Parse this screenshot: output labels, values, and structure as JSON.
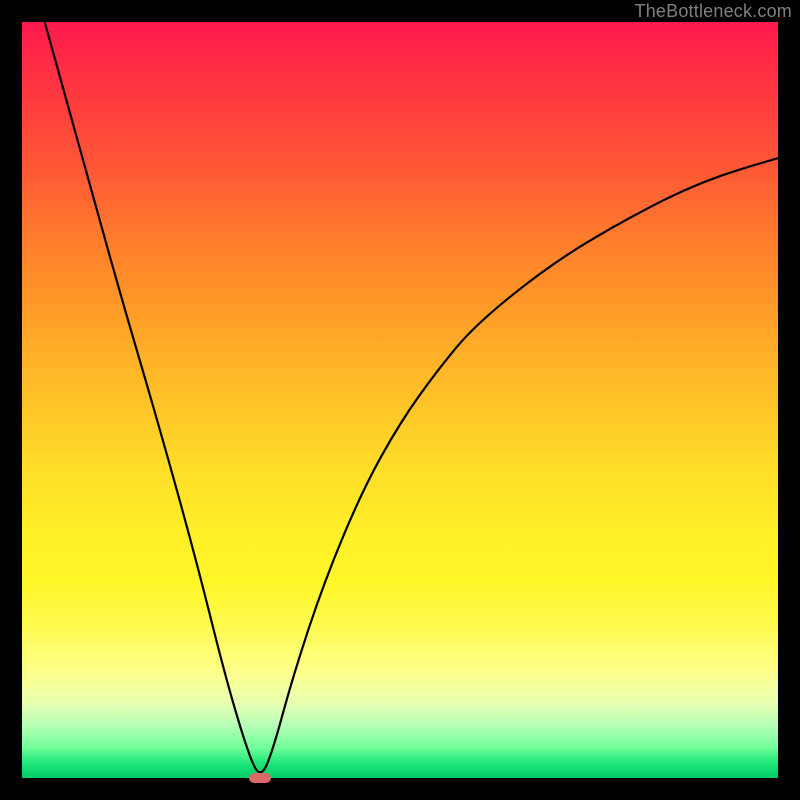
{
  "watermark": "TheBottleneck.com",
  "chart_data": {
    "type": "line",
    "title": "",
    "xlabel": "",
    "ylabel": "",
    "xlim": [
      0,
      100
    ],
    "ylim": [
      0,
      100
    ],
    "grid": false,
    "legend": false,
    "series": [
      {
        "name": "curve",
        "x": [
          3,
          8,
          13,
          18,
          23,
          27,
          30,
          31.5,
          33,
          36,
          40,
          45,
          50,
          55,
          60,
          70,
          80,
          90,
          100
        ],
        "y": [
          100,
          82,
          64,
          47,
          29,
          13,
          3,
          0,
          3,
          14,
          26,
          38,
          47,
          54,
          60,
          68,
          74,
          79,
          82
        ]
      }
    ],
    "marker": {
      "x": 31.5,
      "y": 0,
      "color": "#d86a6a"
    },
    "gradient_stops": [
      {
        "pos": 0.0,
        "color": "#ff1a4d"
      },
      {
        "pos": 0.5,
        "color": "#ffe028"
      },
      {
        "pos": 1.0,
        "color": "#00cc66"
      }
    ]
  }
}
